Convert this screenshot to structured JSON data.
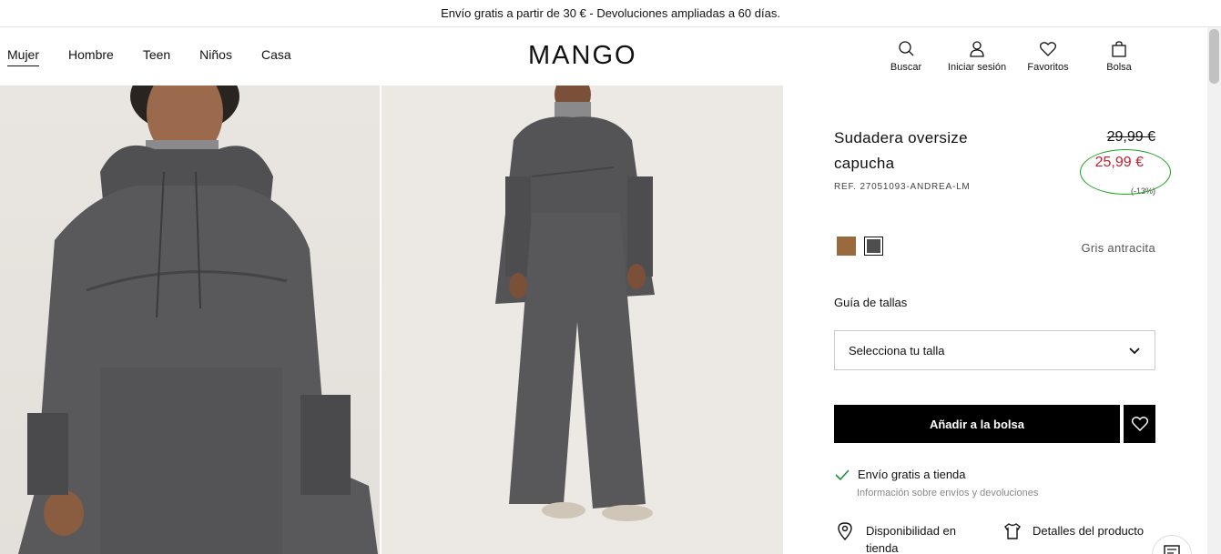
{
  "announcement": "Envío gratis a partir de 30 € - Devoluciones ampliadas a 60 días.",
  "nav": [
    "Mujer",
    "Hombre",
    "Teen",
    "Niños",
    "Casa"
  ],
  "logo": "MANGO",
  "header_icons": {
    "search": "Buscar",
    "login": "Iniciar sesión",
    "favorites": "Favoritos",
    "bag": "Bolsa"
  },
  "product": {
    "title": "Sudadera oversize capucha",
    "ref": "REF. 27051093-ANDREA-LM",
    "old_price": "29,99 €",
    "new_price": "25,99 €",
    "discount": "(-13%)",
    "colors": [
      {
        "name": "marrón",
        "hex": "#9a6a3f"
      },
      {
        "name": "Gris antracita",
        "hex": "#4e4e50",
        "selected": true
      }
    ],
    "color_name": "Gris antracita",
    "size_guide": "Guía de tallas",
    "size_select": "Selecciona tu talla",
    "add_to_bag": "Añadir a la bolsa",
    "shipping": "Envío gratis a tienda",
    "shipping_info": "Información sobre envíos y devoluciones",
    "availability": "Disponibilidad en tienda",
    "details": "Detalles del producto"
  },
  "colors": {
    "accent_red": "#c3202e",
    "annotation_green": "#1ea21e"
  }
}
